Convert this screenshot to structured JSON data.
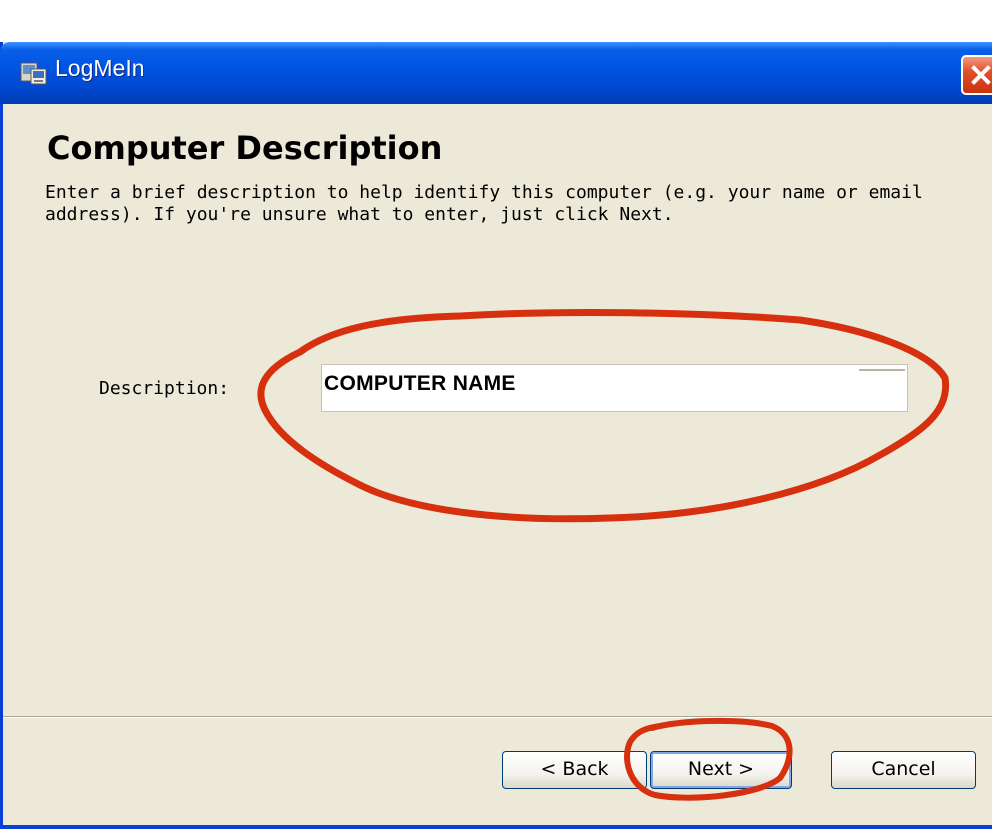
{
  "window": {
    "title": "LogMeIn"
  },
  "page": {
    "heading": "Computer Description",
    "instructions": "Enter a brief description to help identify this computer (e.g. your name or email address). If you're unsure what to enter, just click Next."
  },
  "form": {
    "description_label": "Description:",
    "description_value": "COMPUTER NAME"
  },
  "buttons": {
    "back": "< Back",
    "next": "Next >",
    "cancel": "Cancel"
  },
  "colors": {
    "title_bar": "#0054e3",
    "dialog_background": "#ece9d8",
    "close_button": "#e24f2d",
    "annotation": "#d6300e"
  },
  "icons": {
    "title_icon": "logmein-app-icon",
    "close_icon": "close-icon"
  }
}
